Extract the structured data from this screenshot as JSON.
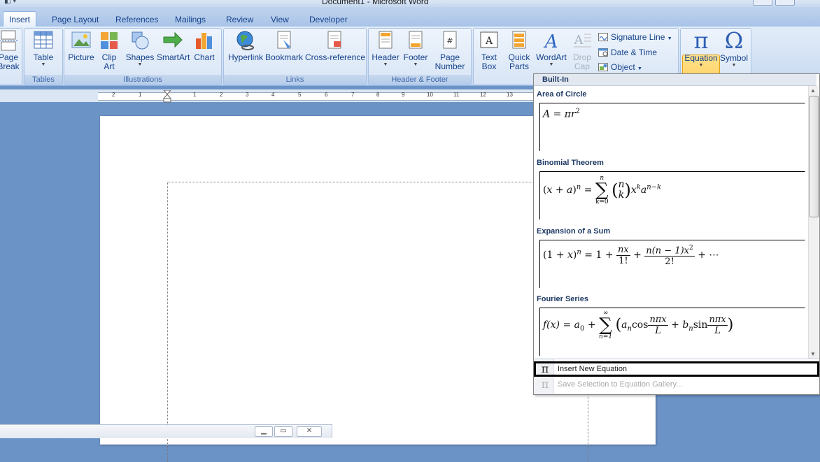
{
  "window": {
    "title": "Document1 - Microsoft Word"
  },
  "tabs": [
    {
      "label": "Insert",
      "active": true
    },
    {
      "label": "Page Layout"
    },
    {
      "label": "References"
    },
    {
      "label": "Mailings"
    },
    {
      "label": "Review"
    },
    {
      "label": "View"
    },
    {
      "label": "Developer"
    }
  ],
  "ribbon": {
    "pages": {
      "page_break": [
        "Page",
        "Break"
      ]
    },
    "tables": {
      "group_label": "Tables",
      "table": "Table"
    },
    "illustrations": {
      "group_label": "Illustrations",
      "picture": "Picture",
      "clip_art": [
        "Clip",
        "Art"
      ],
      "shapes": "Shapes",
      "smartart": "SmartArt",
      "chart": "Chart"
    },
    "links": {
      "group_label": "Links",
      "hyperlink": "Hyperlink",
      "bookmark": "Bookmark",
      "cross_reference": "Cross-reference"
    },
    "header_footer": {
      "group_label": "Header & Footer",
      "header": "Header",
      "footer": "Footer",
      "page_number": [
        "Page",
        "Number"
      ]
    },
    "text": {
      "text_box": [
        "Text",
        "Box"
      ],
      "quick_parts": [
        "Quick",
        "Parts"
      ],
      "wordart": "WordArt",
      "drop_cap": [
        "Drop",
        "Cap"
      ],
      "signature_line": "Signature Line",
      "date_time": "Date & Time",
      "object": "Object"
    },
    "symbols": {
      "equation": "Equation",
      "symbol": "Symbol",
      "equation_glyph": "π",
      "symbol_glyph": "Ω"
    }
  },
  "ruler": {
    "numbers": [
      "2",
      "1",
      "1",
      "2",
      "3",
      "4",
      "5",
      "6",
      "7",
      "8",
      "9",
      "10",
      "11",
      "12",
      "13"
    ]
  },
  "gallery": {
    "header": "Built-In",
    "entries": [
      {
        "title": "Area of Circle"
      },
      {
        "title": "Binomial Theorem"
      },
      {
        "title": "Expansion of a Sum"
      },
      {
        "title": "Fourier Series"
      }
    ],
    "eq": {
      "area": {
        "lhs": "A",
        "eq": " = ",
        "pi": "π",
        "r": "r",
        "exp": "2"
      },
      "binomial": {
        "lhs_open": "(",
        "x": "x",
        "plus": " + ",
        "a": "a",
        "lhs_close": ")",
        "n_sup": "n",
        "eq": " = ",
        "sum_top": "n",
        "sum_sig": "∑",
        "sum_bot": "k=0",
        "binom_n": "n",
        "binom_k": "k",
        "xk_base": "x",
        "xk_exp": "k",
        "ank_base": "a",
        "ank_exp": "n−k"
      },
      "expansion": {
        "lhs": "(1 + ",
        "x": "x",
        "rp": ")",
        "n_sup": "n",
        "eq": " = 1 + ",
        "f1_num": "nx",
        "f1_den": "1!",
        "plus": " + ",
        "f2_num": "n(n − 1)x",
        "f2_num_exp": "2",
        "f2_den": "2!",
        "tail": " + ⋯"
      },
      "fourier": {
        "fx": "f(x)",
        "eq": " = ",
        "a0": "a",
        "a0_sub": "0",
        "plus": " + ",
        "sum_top": "∞",
        "sum_sig": "∑",
        "sum_bot": "n=1",
        "lp": "(",
        "an": "a",
        "an_sub": "n",
        "cos": "cos",
        "c_num": "nπx",
        "c_den": "L",
        "plus2": " + ",
        "bn": "b",
        "bn_sub": "n",
        "sin": "sin",
        "s_num": "nπx",
        "s_den": "L",
        "rp": ")"
      }
    },
    "menu": {
      "insert_new": "Insert New Equation",
      "save_selection": "Save Selection to Equation Gallery...",
      "insert_icon": "π",
      "save_icon": "π"
    }
  },
  "colors": {
    "ribbon_text": "#15428b",
    "highlight": "#ffc84a",
    "app_background": "#6c93c6"
  }
}
